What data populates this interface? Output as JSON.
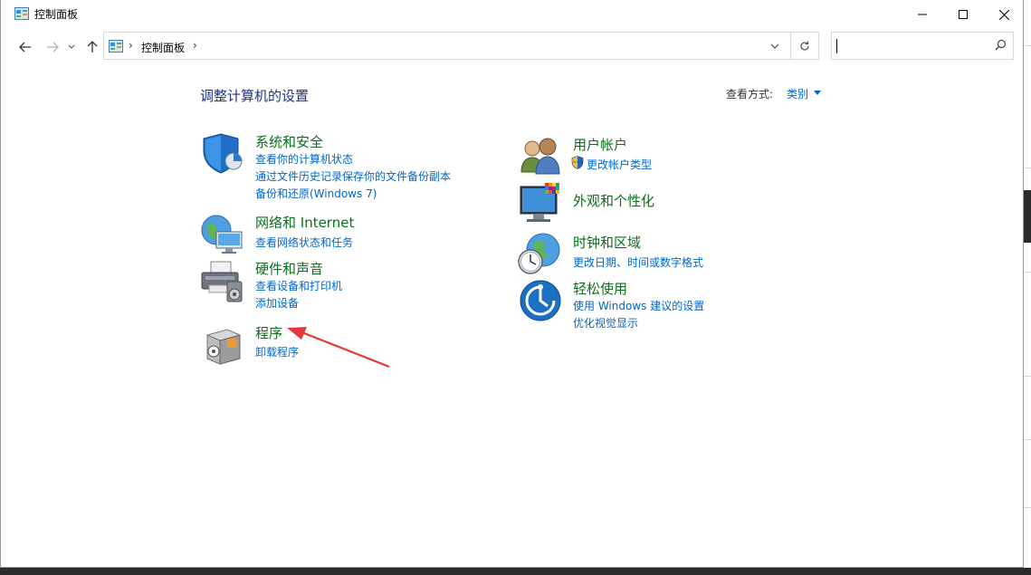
{
  "window": {
    "title": "控制面板",
    "minimize_glyph": "minimize-icon",
    "maximize_glyph": "maximize-icon",
    "close_glyph": "close-icon"
  },
  "addressbar": {
    "breadcrumb": "控制面板",
    "separator": "›"
  },
  "search": {
    "placeholder": "",
    "value": ""
  },
  "header": {
    "title": "调整计算机的设置",
    "view_by_label": "查看方式:",
    "view_by_value": "类别"
  },
  "categories": {
    "system_security": {
      "title": "系统和安全",
      "links": [
        "查看你的计算机状态",
        "通过文件历史记录保存你的文件备份副本",
        "备份和还原(Windows 7)"
      ]
    },
    "network": {
      "title": "网络和 Internet",
      "links": [
        "查看网络状态和任务"
      ]
    },
    "hardware": {
      "title": "硬件和声音",
      "links": [
        "查看设备和打印机",
        "添加设备"
      ]
    },
    "programs": {
      "title": "程序",
      "links": [
        "卸载程序"
      ]
    },
    "user_accounts": {
      "title": "用户帐户",
      "links": [
        "更改帐户类型"
      ]
    },
    "appearance": {
      "title": "外观和个性化",
      "links": []
    },
    "clock_region": {
      "title": "时钟和区域",
      "links": [
        "更改日期、时间或数字格式"
      ]
    },
    "ease_access": {
      "title": "轻松使用",
      "links": [
        "使用 Windows 建议的设置",
        "优化视觉显示"
      ]
    }
  },
  "colors": {
    "category_title": "#0b6e1a",
    "link": "#0066cc",
    "heading": "#1e3287",
    "annotation_arrow": "#e8373a"
  }
}
